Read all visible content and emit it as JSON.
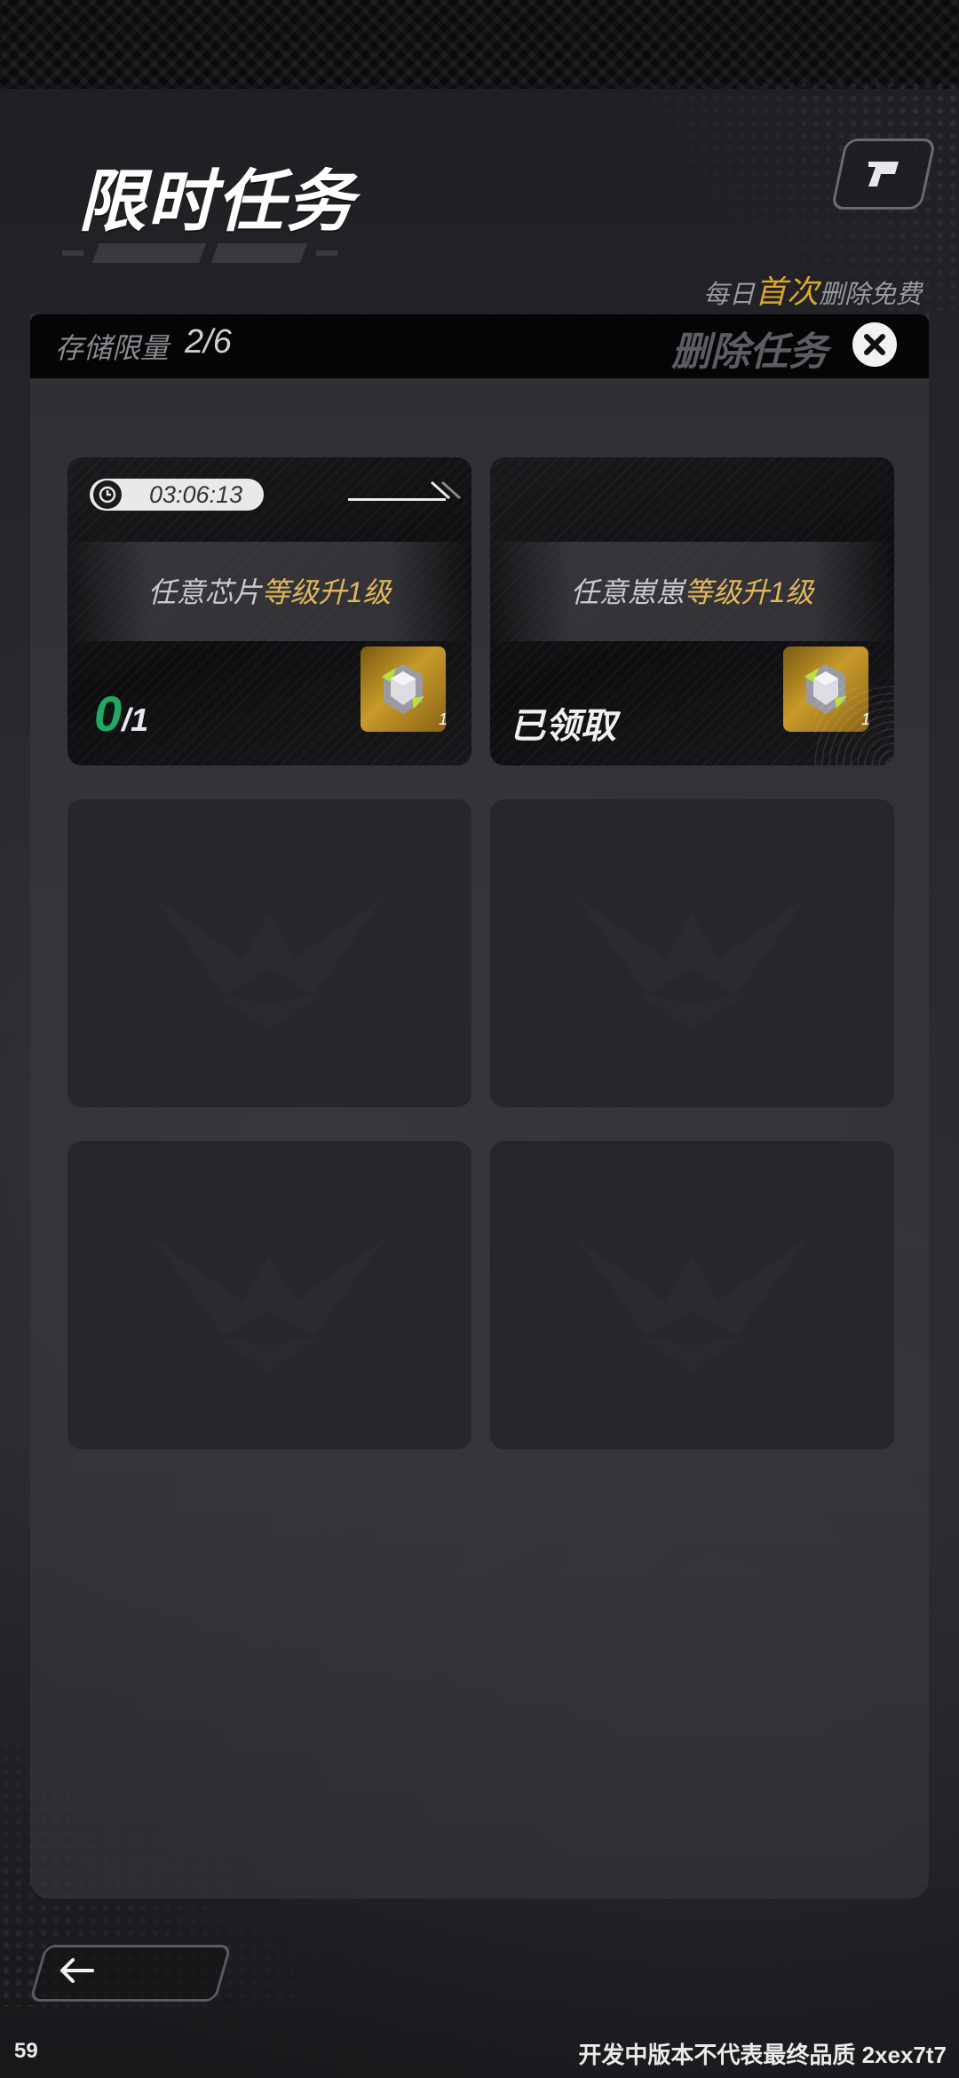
{
  "header": {
    "title": "限时任务",
    "daily_note_prefix": "每日",
    "daily_note_highlight": "首次",
    "daily_note_suffix": "删除免费"
  },
  "panel": {
    "storage_label": "存储限量",
    "storage_count": "2/6",
    "delete_label": "删除任务"
  },
  "tasks": [
    {
      "timer": "03:06:13",
      "task_prefix": "任意芯片",
      "task_highlight": "等级升1级",
      "progress_current": "0",
      "progress_total": "/1",
      "reward_icon": "chip-reward-icon",
      "reward_count": "1"
    },
    {
      "task_prefix": "任意崽崽",
      "task_highlight": "等级升1级",
      "status": "已领取",
      "reward_icon": "chip-reward-icon",
      "reward_count": "1"
    }
  ],
  "footer": {
    "fps": "59",
    "build_note": "开发中版本不代表最终品质 2xex7t7"
  },
  "colors": {
    "accent_gold": "#e0b85c",
    "progress_green": "#21a766",
    "highlight_orange": "#d8a52e"
  }
}
